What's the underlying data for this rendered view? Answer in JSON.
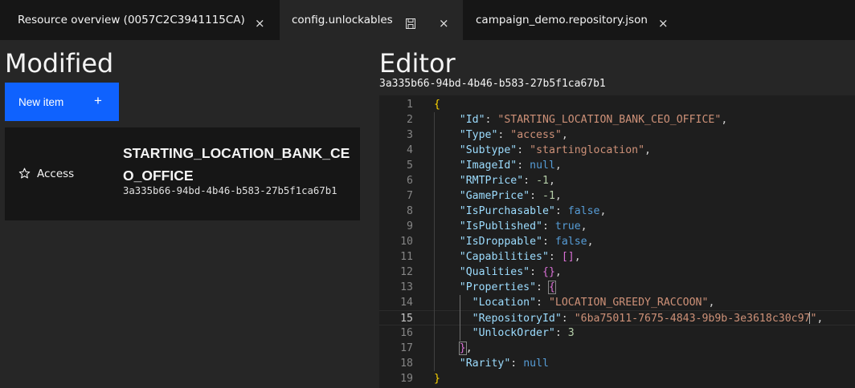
{
  "tabs": [
    {
      "label": "Resource overview (0057C2C3941115CA)",
      "close": "×"
    },
    {
      "label": "config.unlockables",
      "close": "×",
      "active": true
    },
    {
      "label": "campaign_demo.repository.json",
      "close": "×"
    }
  ],
  "left": {
    "title": "Modified",
    "new_item_label": "New item",
    "new_item_icon": "+",
    "items": [
      {
        "type": "Access",
        "icon": "star-icon",
        "name": "STARTING_LOCATION_BANK_CEO_OFFICE",
        "guid": "3a335b66-94bd-4b46-b583-27b5f1ca67b1"
      }
    ]
  },
  "editor": {
    "title": "Editor",
    "guid": "3a335b66-94bd-4b46-b583-27b5f1ca67b1",
    "current_line": 15,
    "lines": [
      [
        [
          "b1",
          "{"
        ]
      ],
      [
        [
          "p",
          "    "
        ],
        [
          "k",
          "\"Id\""
        ],
        [
          "p",
          ": "
        ],
        [
          "s",
          "\"STARTING_LOCATION_BANK_CEO_OFFICE\""
        ],
        [
          "p",
          ","
        ]
      ],
      [
        [
          "p",
          "    "
        ],
        [
          "k",
          "\"Type\""
        ],
        [
          "p",
          ": "
        ],
        [
          "s",
          "\"access\""
        ],
        [
          "p",
          ","
        ]
      ],
      [
        [
          "p",
          "    "
        ],
        [
          "k",
          "\"Subtype\""
        ],
        [
          "p",
          ": "
        ],
        [
          "s",
          "\"startinglocation\""
        ],
        [
          "p",
          ","
        ]
      ],
      [
        [
          "p",
          "    "
        ],
        [
          "k",
          "\"ImageId\""
        ],
        [
          "p",
          ": "
        ],
        [
          "l",
          "null"
        ],
        [
          "p",
          ","
        ]
      ],
      [
        [
          "p",
          "    "
        ],
        [
          "k",
          "\"RMTPrice\""
        ],
        [
          "p",
          ": "
        ],
        [
          "n",
          "-1"
        ],
        [
          "p",
          ","
        ]
      ],
      [
        [
          "p",
          "    "
        ],
        [
          "k",
          "\"GamePrice\""
        ],
        [
          "p",
          ": "
        ],
        [
          "n",
          "-1"
        ],
        [
          "p",
          ","
        ]
      ],
      [
        [
          "p",
          "    "
        ],
        [
          "k",
          "\"IsPurchasable\""
        ],
        [
          "p",
          ": "
        ],
        [
          "l",
          "false"
        ],
        [
          "p",
          ","
        ]
      ],
      [
        [
          "p",
          "    "
        ],
        [
          "k",
          "\"IsPublished\""
        ],
        [
          "p",
          ": "
        ],
        [
          "l",
          "true"
        ],
        [
          "p",
          ","
        ]
      ],
      [
        [
          "p",
          "    "
        ],
        [
          "k",
          "\"IsDroppable\""
        ],
        [
          "p",
          ": "
        ],
        [
          "l",
          "false"
        ],
        [
          "p",
          ","
        ]
      ],
      [
        [
          "p",
          "    "
        ],
        [
          "k",
          "\"Capabilities\""
        ],
        [
          "p",
          ": "
        ],
        [
          "b2",
          "[]"
        ],
        [
          "p",
          ","
        ]
      ],
      [
        [
          "p",
          "    "
        ],
        [
          "k",
          "\"Qualities\""
        ],
        [
          "p",
          ": "
        ],
        [
          "b2",
          "{}"
        ],
        [
          "p",
          ","
        ]
      ],
      [
        [
          "p",
          "    "
        ],
        [
          "k",
          "\"Properties\""
        ],
        [
          "p",
          ": "
        ],
        [
          "b2bb",
          "{"
        ]
      ],
      [
        [
          "p",
          "      "
        ],
        [
          "k",
          "\"Location\""
        ],
        [
          "p",
          ": "
        ],
        [
          "s",
          "\"LOCATION_GREEDY_RACCOON\""
        ],
        [
          "p",
          ","
        ]
      ],
      [
        [
          "p",
          "      "
        ],
        [
          "k",
          "\"RepositoryId\""
        ],
        [
          "p",
          ": "
        ],
        [
          "s",
          "\"6ba75011-7675-4843-9b9b-3e3618c30c97"
        ],
        [
          "cursor",
          ""
        ],
        [
          "s",
          "\""
        ],
        [
          "p",
          ","
        ]
      ],
      [
        [
          "p",
          "      "
        ],
        [
          "k",
          "\"UnlockOrder\""
        ],
        [
          "p",
          ": "
        ],
        [
          "n",
          "3"
        ]
      ],
      [
        [
          "p",
          "    "
        ],
        [
          "b2bb",
          "}"
        ],
        [
          "p",
          ","
        ]
      ],
      [
        [
          "p",
          "    "
        ],
        [
          "k",
          "\"Rarity\""
        ],
        [
          "p",
          ": "
        ],
        [
          "l",
          "null"
        ]
      ],
      [
        [
          "b1",
          "}"
        ]
      ]
    ]
  }
}
